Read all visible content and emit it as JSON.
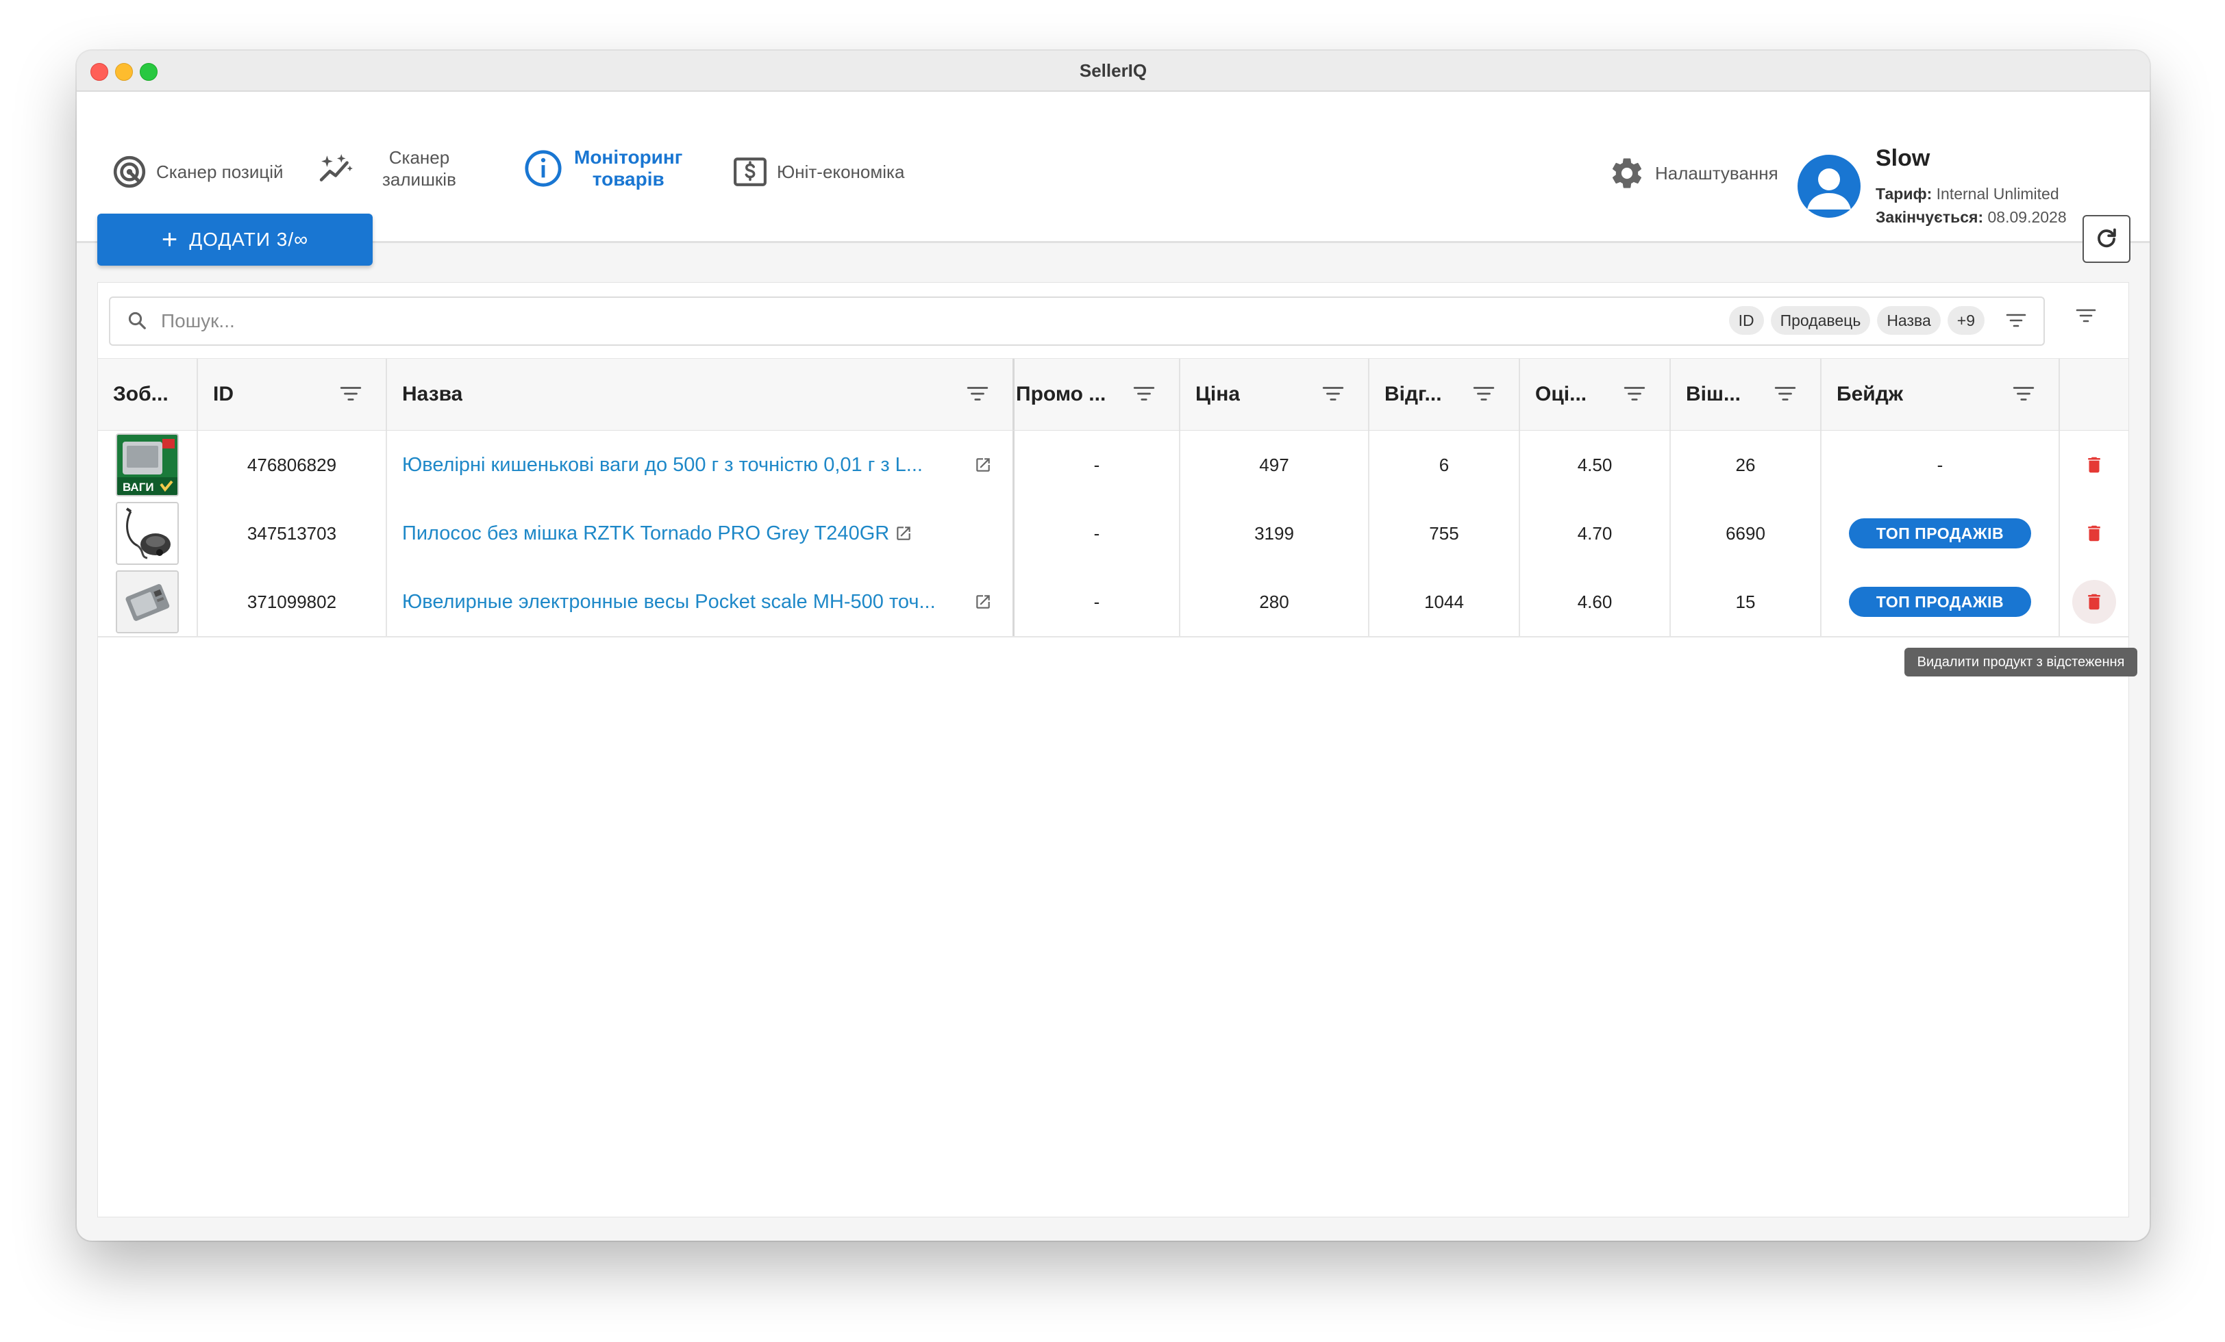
{
  "window": {
    "title": "SellerIQ"
  },
  "nav": {
    "items": [
      {
        "label": "Сканер позицій",
        "icon": "target-icon"
      },
      {
        "label_line1": "Сканер",
        "label_line2": "залишків",
        "icon": "sparkle-chart-icon"
      },
      {
        "label_line1": "Моніторинг",
        "label_line2": "товарів",
        "icon": "info-circle-icon",
        "active": true
      },
      {
        "label": "Юніт-економіка",
        "icon": "dollar-box-icon"
      }
    ],
    "settings_label": "Налаштування"
  },
  "user": {
    "name": "Slow",
    "plan_label": "Тариф:",
    "plan_value": "Internal Unlimited",
    "expires_label": "Закінчується:",
    "expires_value": "08.09.2028"
  },
  "toolbar": {
    "add_label": "ДОДАТИ 3/∞"
  },
  "search": {
    "placeholder": "Пошук...",
    "chips": [
      "ID",
      "Продавець",
      "Назва",
      "+9"
    ]
  },
  "table": {
    "columns": [
      "Зоб...",
      "ID",
      "Назва",
      "Промо ...",
      "Ціна",
      "Відг...",
      "Оці...",
      "Віш...",
      "Бейдж"
    ],
    "rows": [
      {
        "thumb_text": "ВАГИ",
        "id": "476806829",
        "name": "Ювелірні кишенькові ваги до 500 г з точністю 0,01 г з L...",
        "promo": "-",
        "price": "497",
        "reviews": "6",
        "rating": "4.50",
        "wishlist": "26",
        "badge": "-"
      },
      {
        "id": "347513703",
        "name": "Пилосос без мішка RZTK Tornado PRO Grey T240GR",
        "promo": "-",
        "price": "3199",
        "reviews": "755",
        "rating": "4.70",
        "wishlist": "6690",
        "badge": "ТОП ПРОДАЖІВ"
      },
      {
        "id": "371099802",
        "name": "Ювелирные электронные весы Pocket scale MH-500 точ...",
        "promo": "-",
        "price": "280",
        "reviews": "1044",
        "rating": "4.60",
        "wishlist": "15",
        "badge": "ТОП ПРОДАЖІВ"
      }
    ]
  },
  "tooltip": {
    "text": "Видалити продукт з відстеження"
  },
  "colors": {
    "accent": "#1976d2",
    "link": "#1e88c8",
    "danger": "#e53935"
  }
}
